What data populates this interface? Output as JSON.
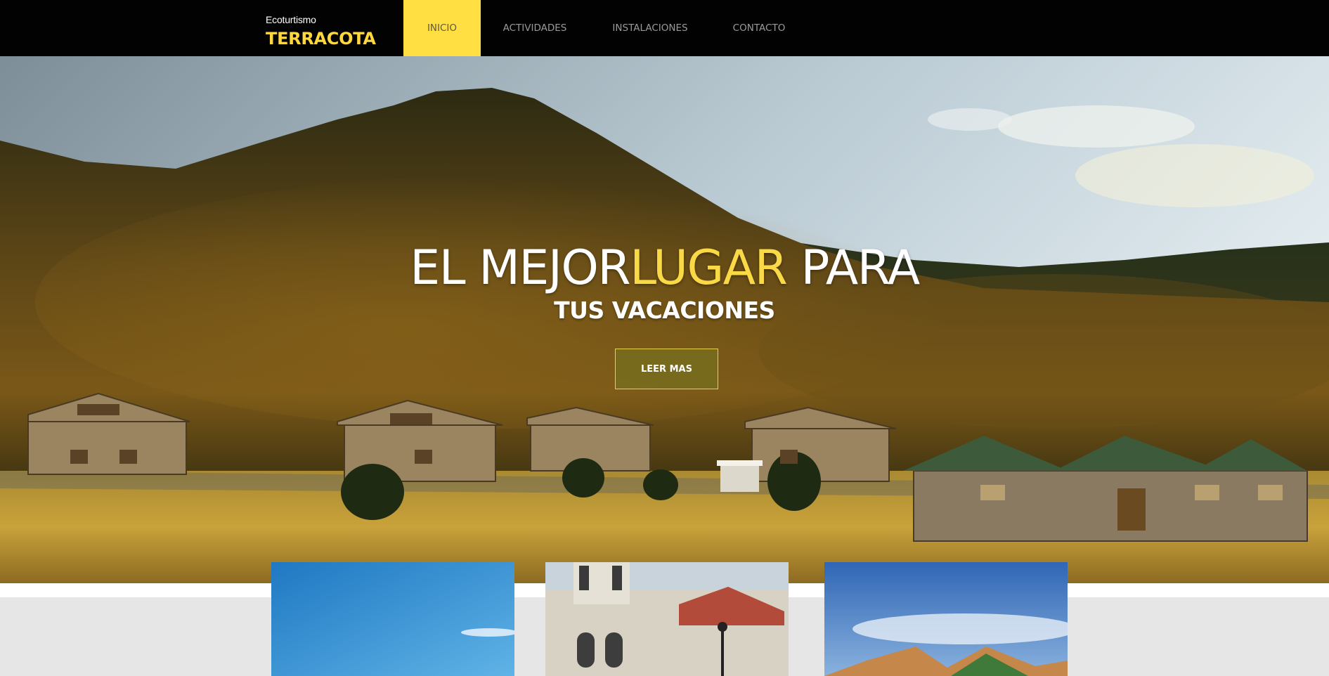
{
  "header": {
    "brand_small": "Ecoturtismo",
    "brand_big": "TERRACOTA",
    "nav": [
      {
        "label": "INICIO",
        "active": true
      },
      {
        "label": "ACTIVIDADES",
        "active": false
      },
      {
        "label": "INSTALACIONES",
        "active": false
      },
      {
        "label": "CONTACTO",
        "active": false
      }
    ]
  },
  "hero": {
    "title_part1": "EL MEJOR",
    "title_highlight": "LUGAR",
    "title_part2": " PARA",
    "subtitle": "TUS VACACIONES",
    "button_label": "LEER MAS"
  },
  "colors": {
    "accent": "#ffdf41",
    "header_bg": "#020202",
    "section_bg": "#e6e6e6"
  }
}
